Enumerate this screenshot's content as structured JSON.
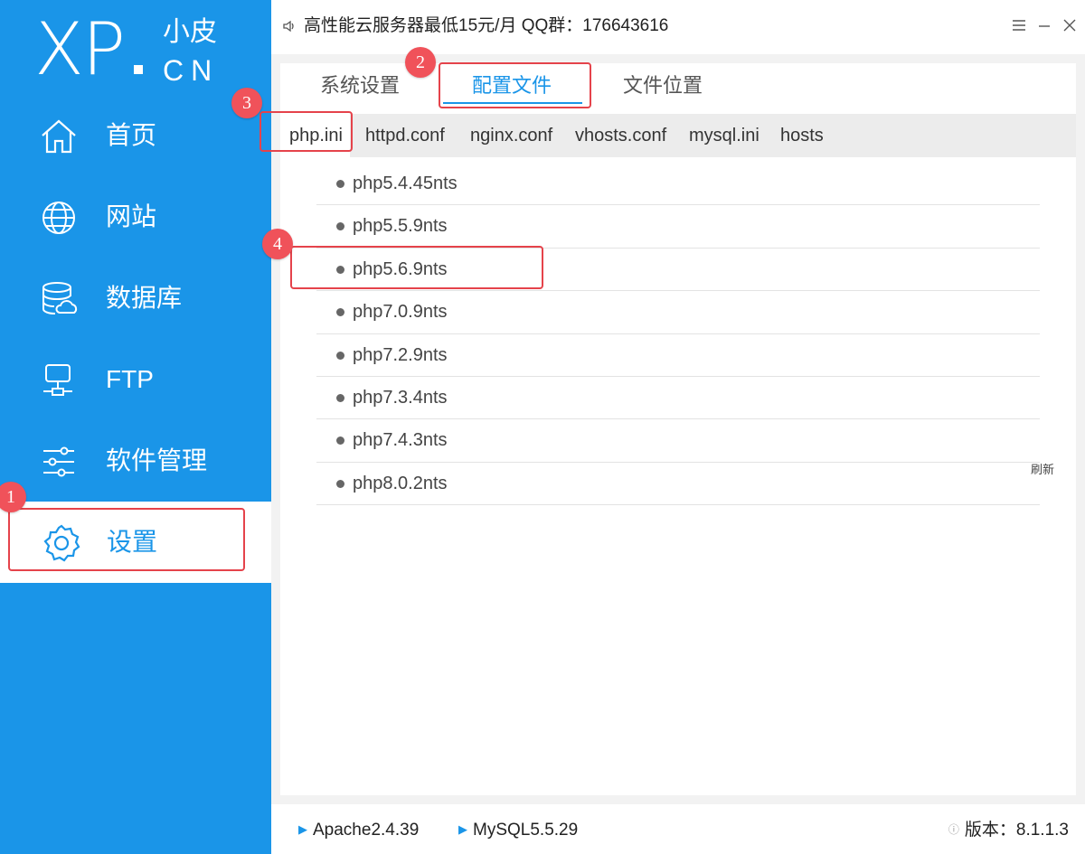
{
  "sidebar": {
    "logo": {
      "main": "XP",
      "cn_top": "小皮",
      "cn_bottom": "CN"
    },
    "items": [
      {
        "label": "首页",
        "icon": "home-icon"
      },
      {
        "label": "网站",
        "icon": "globe-icon"
      },
      {
        "label": "数据库",
        "icon": "database-icon"
      },
      {
        "label": "FTP",
        "icon": "ftp-server-icon"
      },
      {
        "label": "软件管理",
        "icon": "sliders-icon"
      },
      {
        "label": "设置",
        "icon": "gear-icon"
      }
    ],
    "active_index": 5
  },
  "titlebar": {
    "notice": "高性能云服务器最低15元/月  QQ群：176643616",
    "menu_icon": "menu-icon",
    "minimize_icon": "minimize-icon",
    "close_icon": "close-icon"
  },
  "tabs": [
    {
      "label": "系统设置"
    },
    {
      "label": "配置文件"
    },
    {
      "label": "文件位置"
    }
  ],
  "active_tab": 1,
  "subtabs": [
    {
      "label": "php.ini"
    },
    {
      "label": "httpd.conf"
    },
    {
      "label": "nginx.conf"
    },
    {
      "label": "vhosts.conf"
    },
    {
      "label": "mysql.ini"
    },
    {
      "label": "hosts"
    }
  ],
  "active_subtab": 0,
  "files": [
    {
      "name": "php5.4.45nts"
    },
    {
      "name": "php5.5.9nts"
    },
    {
      "name": "php5.6.9nts"
    },
    {
      "name": "php7.0.9nts"
    },
    {
      "name": "php7.2.9nts"
    },
    {
      "name": "php7.3.4nts"
    },
    {
      "name": "php7.4.3nts"
    },
    {
      "name": "php8.0.2nts"
    }
  ],
  "refresh_label": "刷新",
  "annotations": [
    "1",
    "2",
    "3",
    "4"
  ],
  "statusbar": {
    "apache": "Apache2.4.39",
    "mysql": "MySQL5.5.29",
    "version_label": "版本：",
    "version": "8.1.1.3"
  },
  "colors": {
    "accent": "#1a95e8",
    "annotation": "#e5434b"
  }
}
